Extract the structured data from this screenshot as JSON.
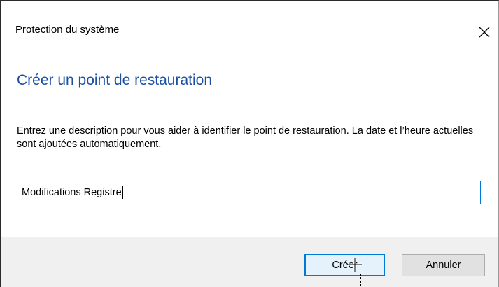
{
  "window": {
    "title": "Protection du système"
  },
  "dialog": {
    "heading": "Créer un point de restauration",
    "description": "Entrez une description pour vous aider à identifier le point de restauration. La date et l’heure actuelles sont ajoutées automatiquement.",
    "input_value": "Modifications Registre"
  },
  "buttons": {
    "create_label": "Créer",
    "cancel_label": "Annuler"
  },
  "icons": {
    "close": "close-icon",
    "cursor": "move-cursor-icon"
  },
  "colors": {
    "heading": "#1a4fa3",
    "focus_border": "#0078d7",
    "footer_bg": "#f0f0f0"
  }
}
